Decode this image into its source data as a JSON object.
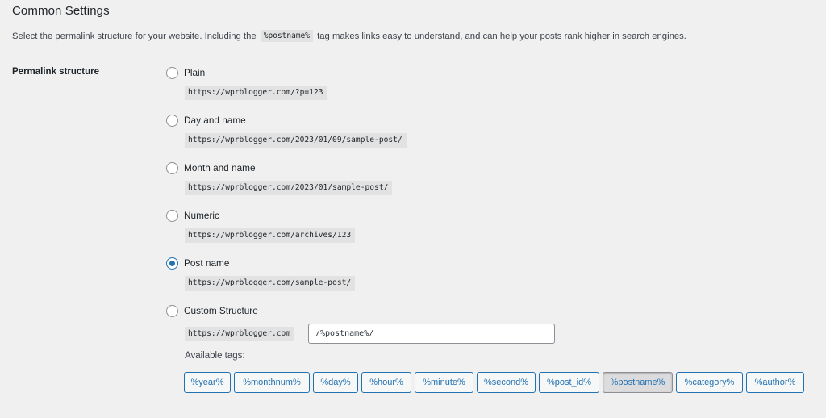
{
  "section": {
    "title": "Common Settings",
    "intro_before": "Select the permalink structure for your website. Including the",
    "intro_code": "%postname%",
    "intro_after": "tag makes links easy to understand, and can help your posts rank higher in search engines."
  },
  "permalink": {
    "label": "Permalink structure",
    "options": [
      {
        "label": "Plain",
        "example": "https://wprblogger.com/?p=123",
        "checked": false
      },
      {
        "label": "Day and name",
        "example": "https://wprblogger.com/2023/01/09/sample-post/",
        "checked": false
      },
      {
        "label": "Month and name",
        "example": "https://wprblogger.com/2023/01/sample-post/",
        "checked": false
      },
      {
        "label": "Numeric",
        "example": "https://wprblogger.com/archives/123",
        "checked": false
      },
      {
        "label": "Post name",
        "example": "https://wprblogger.com/sample-post/",
        "checked": true
      },
      {
        "label": "Custom Structure",
        "example": "https://wprblogger.com",
        "checked": false
      }
    ],
    "custom_value": "/%postname%/",
    "available_tags_label": "Available tags:",
    "tags": [
      {
        "label": "%year%",
        "active": false
      },
      {
        "label": "%monthnum%",
        "active": false
      },
      {
        "label": "%day%",
        "active": false
      },
      {
        "label": "%hour%",
        "active": false
      },
      {
        "label": "%minute%",
        "active": false
      },
      {
        "label": "%second%",
        "active": false
      },
      {
        "label": "%post_id%",
        "active": false
      },
      {
        "label": "%postname%",
        "active": true
      },
      {
        "label": "%category%",
        "active": false
      },
      {
        "label": "%author%",
        "active": false
      }
    ]
  },
  "colors": {
    "accent": "#2271b1",
    "background": "#f0f0f1",
    "code_background": "#e2e2e3"
  }
}
